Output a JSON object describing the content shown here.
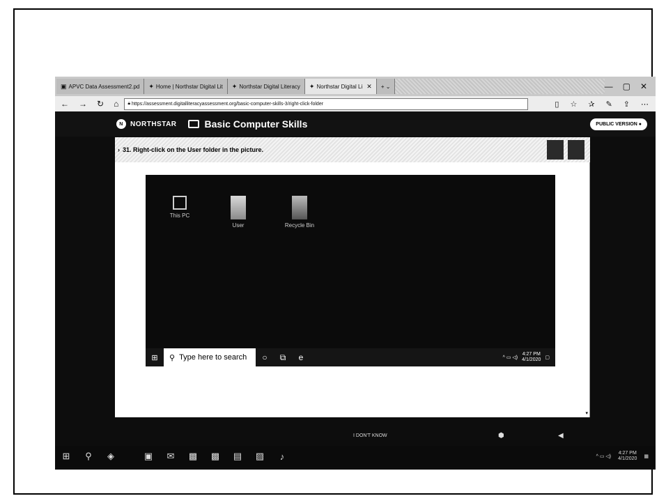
{
  "browser": {
    "tabs": [
      {
        "label": "APVC Data Assessment2.pd",
        "active": false
      },
      {
        "label": "Home | Northstar Digital Lit",
        "active": false
      },
      {
        "label": "Northstar Digital Literacy",
        "active": false
      },
      {
        "label": "Northstar Digital Li",
        "active": true
      }
    ],
    "url": "https://assessment.digitalliteracyassessment.org/basic-computer-skills-3/right-click-folder"
  },
  "site": {
    "logo_text": "NORTHSTAR",
    "course_title": "Basic Computer Skills",
    "public_version_label": "PUBLIC VERSION"
  },
  "question": {
    "text": "31. Right-click on the User folder in the picture."
  },
  "desktop": {
    "icons": [
      {
        "label": "This PC",
        "icon": "this-pc-icon"
      },
      {
        "label": "User",
        "icon": "user-folder-icon"
      },
      {
        "label": "Recycle Bin",
        "icon": "recycle-bin-icon"
      }
    ],
    "search_placeholder": "Type here to search",
    "tray_time": "4:27 PM",
    "tray_date": "4/1/2020"
  },
  "site_footer": {
    "dont_know": "I DON'T KNOW"
  },
  "outer_taskbar": {
    "time": "4:27 PM",
    "date": "4/1/2020"
  }
}
